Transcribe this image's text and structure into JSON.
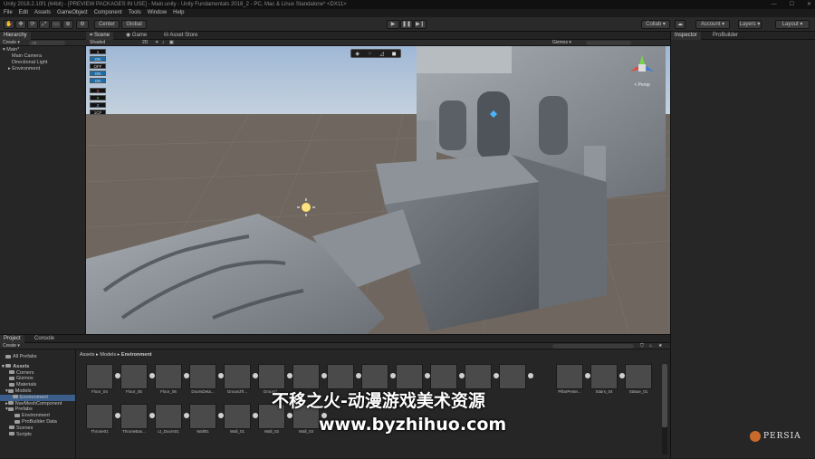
{
  "window": {
    "title": "Unity 2018.2.10f1 (64bit) - [PREVIEW PACKAGES IN USE] - Main.unity - Unity Fundamentals 2018_2 - PC, Mac & Linux Standalone* <DX11>",
    "controls": [
      "—",
      "☐",
      "✕"
    ]
  },
  "menu": [
    "File",
    "Edit",
    "Assets",
    "GameObject",
    "Component",
    "Tools",
    "Window",
    "Help"
  ],
  "toolbar": {
    "pivot_label": "Center",
    "space_label": "Global",
    "collab_label": "Collab ▾",
    "account_label": "Account ▾",
    "layers_label": "Layers ▾",
    "layout_label": "Layout ▾"
  },
  "hierarchy": {
    "tab": "Hierarchy",
    "create": "Create ▾",
    "search_placeholder": "All",
    "rows": [
      "▾ Main*",
      "Main Camera",
      "Directional Light",
      "▸ Environment"
    ]
  },
  "scene": {
    "tabs": [
      "Scene",
      "Game",
      "Asset Store"
    ],
    "shaded": "Shaded",
    "mode_2d": "2D",
    "gizmos": "Gizmos ▾",
    "persp": "< Persp",
    "tool_buttons": [
      "1",
      "ON",
      "OFF",
      "ON",
      "ON",
      "X",
      "Y",
      "Z",
      "1CF"
    ]
  },
  "inspector": {
    "tabs": [
      "Inspector",
      "ProBuilder"
    ]
  },
  "project": {
    "tabs": [
      "Project",
      "Console"
    ],
    "create": "Create ▾",
    "breadcrumb": [
      "Assets",
      "Models",
      "Environment"
    ],
    "tree": [
      {
        "label": "All Prefabs",
        "indent": 1
      },
      {
        "label": "Assets",
        "indent": 0,
        "bold": true
      },
      {
        "label": "Corners",
        "indent": 1
      },
      {
        "label": "Gizmos",
        "indent": 1
      },
      {
        "label": "Materials",
        "indent": 1
      },
      {
        "label": "Models",
        "indent": 1
      },
      {
        "label": "Environment",
        "indent": 2,
        "selected": true
      },
      {
        "label": "NavMeshComponent",
        "indent": 1
      },
      {
        "label": "Prefabs",
        "indent": 1
      },
      {
        "label": "Environment",
        "indent": 2
      },
      {
        "label": "ProBuilder Data",
        "indent": 2
      },
      {
        "label": "Scenes",
        "indent": 1
      },
      {
        "label": "Scripts",
        "indent": 1
      }
    ],
    "assets_row1": [
      "Floor_04",
      "Floor_05",
      "Floor_06",
      "DoorsDeta...",
      "GroundTi...",
      "Ground...",
      "",
      "",
      "",
      "",
      "",
      "",
      "",
      "PillarPeste...",
      "Stairs_04",
      "Statue_01"
    ],
    "assets_row2": [
      "Throne01",
      "ThroneBas...",
      "Lt_Doors01",
      "Wall01",
      "Wall_01",
      "Wall_02",
      "Wall_03",
      "",
      "",
      "",
      "",
      "",
      "",
      "",
      "",
      ""
    ]
  },
  "watermark": {
    "line1": "不移之火-动漫游戏美术资源",
    "line2": "www.byzhihuo.com",
    "badge": "PERSIA"
  }
}
